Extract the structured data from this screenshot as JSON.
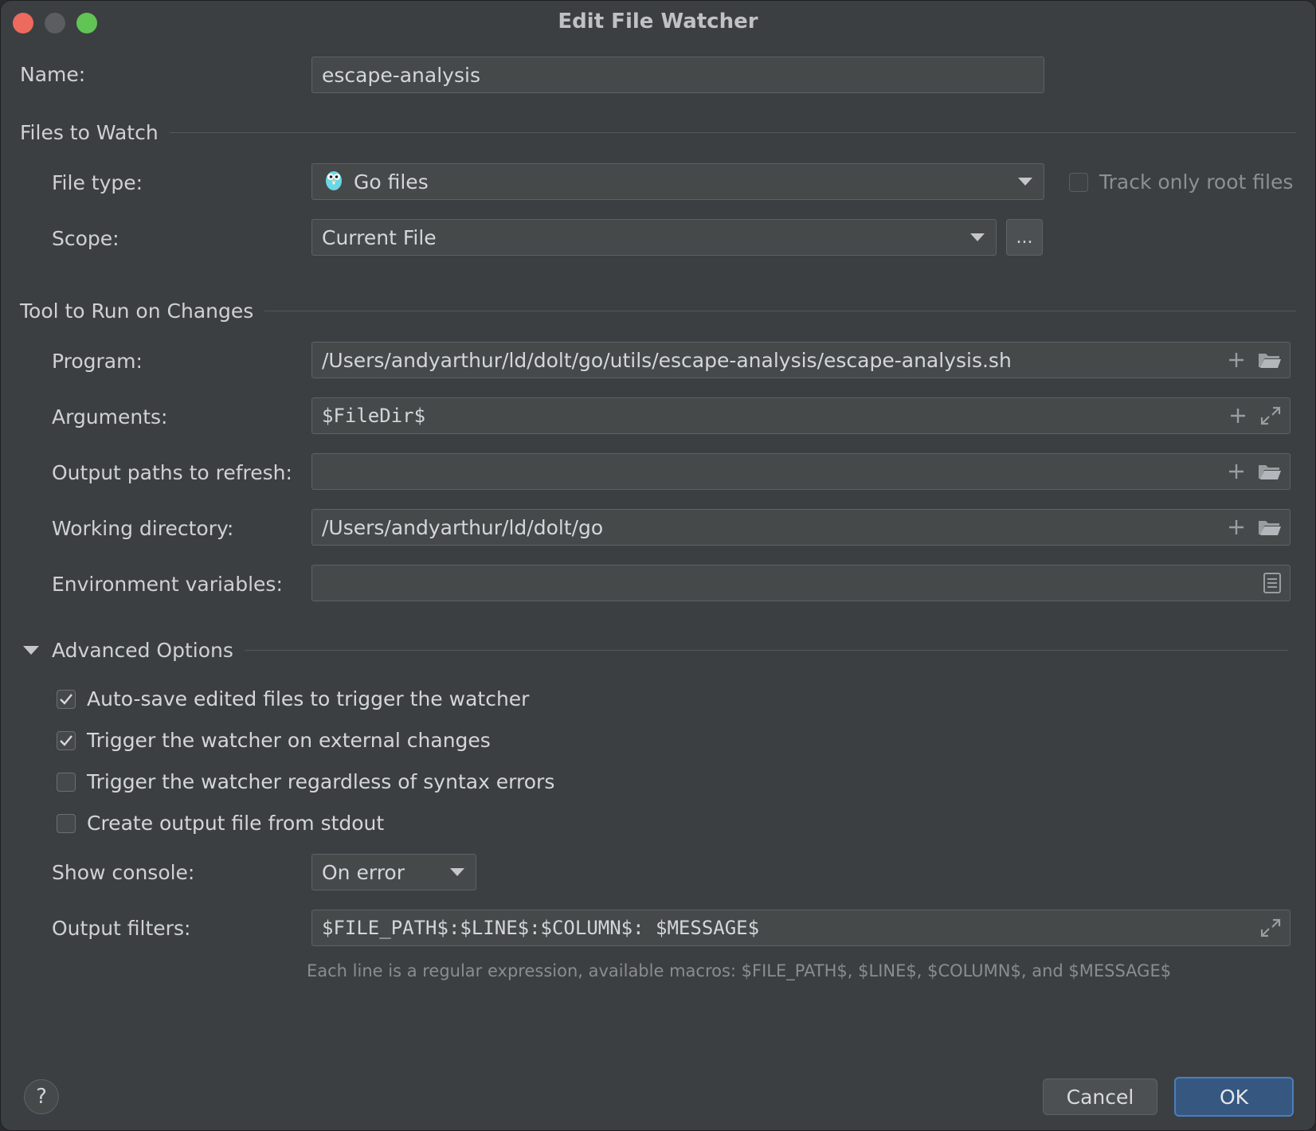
{
  "window": {
    "title": "Edit File Watcher"
  },
  "name": {
    "label": "Name:",
    "value": "escape-analysis"
  },
  "files_to_watch": {
    "heading": "Files to Watch",
    "file_type": {
      "label": "File type:",
      "value": "Go files",
      "icon": "go-gopher-icon"
    },
    "track_root": {
      "label": "Track only root files",
      "checked": false
    },
    "scope": {
      "label": "Scope:",
      "value": "Current File",
      "more_label": "..."
    }
  },
  "tool": {
    "heading": "Tool to Run on Changes",
    "program": {
      "label": "Program:",
      "value": "/Users/andyarthur/ld/dolt/go/utils/escape-analysis/escape-analysis.sh"
    },
    "arguments": {
      "label": "Arguments:",
      "value": "$FileDir$"
    },
    "output_paths": {
      "label": "Output paths to refresh:",
      "value": ""
    },
    "working_dir": {
      "label": "Working directory:",
      "value": "/Users/andyarthur/ld/dolt/go"
    },
    "env_vars": {
      "label": "Environment variables:",
      "value": ""
    }
  },
  "advanced": {
    "heading": "Advanced Options",
    "options": [
      {
        "label": "Auto-save edited files to trigger the watcher",
        "checked": true
      },
      {
        "label": "Trigger the watcher on external changes",
        "checked": true
      },
      {
        "label": "Trigger the watcher regardless of syntax errors",
        "checked": false
      },
      {
        "label": "Create output file from stdout",
        "checked": false
      }
    ],
    "show_console": {
      "label": "Show console:",
      "value": "On error"
    },
    "output_filters": {
      "label": "Output filters:",
      "value": "$FILE_PATH$:$LINE$:$COLUMN$: $MESSAGE$"
    },
    "hint": "Each line is a regular expression, available macros: $FILE_PATH$, $LINE$, $COLUMN$, and $MESSAGE$"
  },
  "footer": {
    "help_label": "?",
    "cancel_label": "Cancel",
    "ok_label": "OK"
  },
  "colors": {
    "background": "#3c3f41",
    "field": "#45494a",
    "accent": "#365880"
  }
}
